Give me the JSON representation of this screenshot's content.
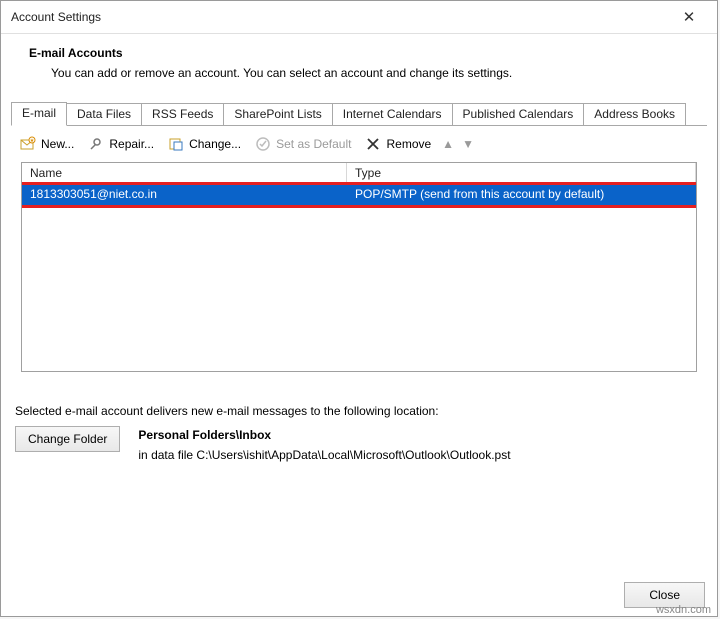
{
  "window": {
    "title": "Account Settings"
  },
  "header": {
    "title": "E-mail Accounts",
    "subtitle": "You can add or remove an account. You can select an account and change its settings."
  },
  "tabs": [
    {
      "label": "E-mail",
      "active": true
    },
    {
      "label": "Data Files"
    },
    {
      "label": "RSS Feeds"
    },
    {
      "label": "SharePoint Lists"
    },
    {
      "label": "Internet Calendars"
    },
    {
      "label": "Published Calendars"
    },
    {
      "label": "Address Books"
    }
  ],
  "toolbar": {
    "new_label": "New...",
    "repair_label": "Repair...",
    "change_label": "Change...",
    "set_default_label": "Set as Default",
    "remove_label": "Remove"
  },
  "grid": {
    "columns": {
      "name": "Name",
      "type": "Type"
    },
    "rows": [
      {
        "name": "1813303051@niet.co.in",
        "type": "POP/SMTP (send from this account by default)",
        "selected": true
      }
    ]
  },
  "delivery": {
    "label": "Selected e-mail account delivers new e-mail messages to the following location:",
    "change_folder_label": "Change Folder",
    "folder": "Personal Folders\\Inbox",
    "path": "in data file C:\\Users\\ishit\\AppData\\Local\\Microsoft\\Outlook\\Outlook.pst"
  },
  "footer": {
    "close_label": "Close"
  },
  "watermark": "wsxdn.com"
}
